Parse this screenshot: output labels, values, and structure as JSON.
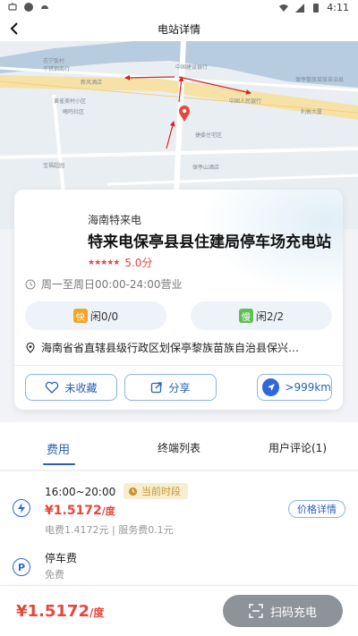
{
  "status": {
    "time": "4:11"
  },
  "nav": {
    "title": "电站详情"
  },
  "map": {
    "labels": [
      "志宁饭村",
      "不锈钢商行",
      "新风酒店",
      "黄雀美村小区",
      "曦鸣社区",
      "中国建设银行",
      "保亭黎族苗族自治县",
      "中国人民银行",
      "利敦大厦",
      "捷委住宅区",
      "保亭山酒店",
      "宝福超园"
    ]
  },
  "station": {
    "operator": "海南特来电",
    "name": "特来电保亭县县住建局停车场充电站",
    "stars": "★★★★★",
    "score": "5.0分",
    "hours": "周一至周日00:00-24:00营业",
    "fast_badge": "快",
    "fast_status": "闲0/0",
    "slow_badge": "慢",
    "slow_status": "闲2/2",
    "address": "海南省省直辖县级行政区划保亭黎族苗族自治县保兴…"
  },
  "actions": {
    "favorite": "未收藏",
    "share": "分享",
    "distance": ">999km"
  },
  "tabs": [
    {
      "label": "费用"
    },
    {
      "label": "终端列表"
    },
    {
      "label": "用户评论(1)"
    }
  ],
  "fee": {
    "time_range": "16:00~20:00",
    "current_label": "当前时段",
    "price": "¥1.5172",
    "price_unit": "/度",
    "detail": "电费1.4172元 | 服务费0.1元",
    "price_detail_button": "价格详情",
    "parking_title": "停车费",
    "parking_value": "免费"
  },
  "bottom": {
    "price": "¥1.5172",
    "unit": "/度",
    "scan_button": "扫码充电"
  },
  "colors": {
    "accent": "#2a5fb6",
    "price": "#e8463a",
    "fast": "#f3a524",
    "slow": "#5fbf54"
  }
}
